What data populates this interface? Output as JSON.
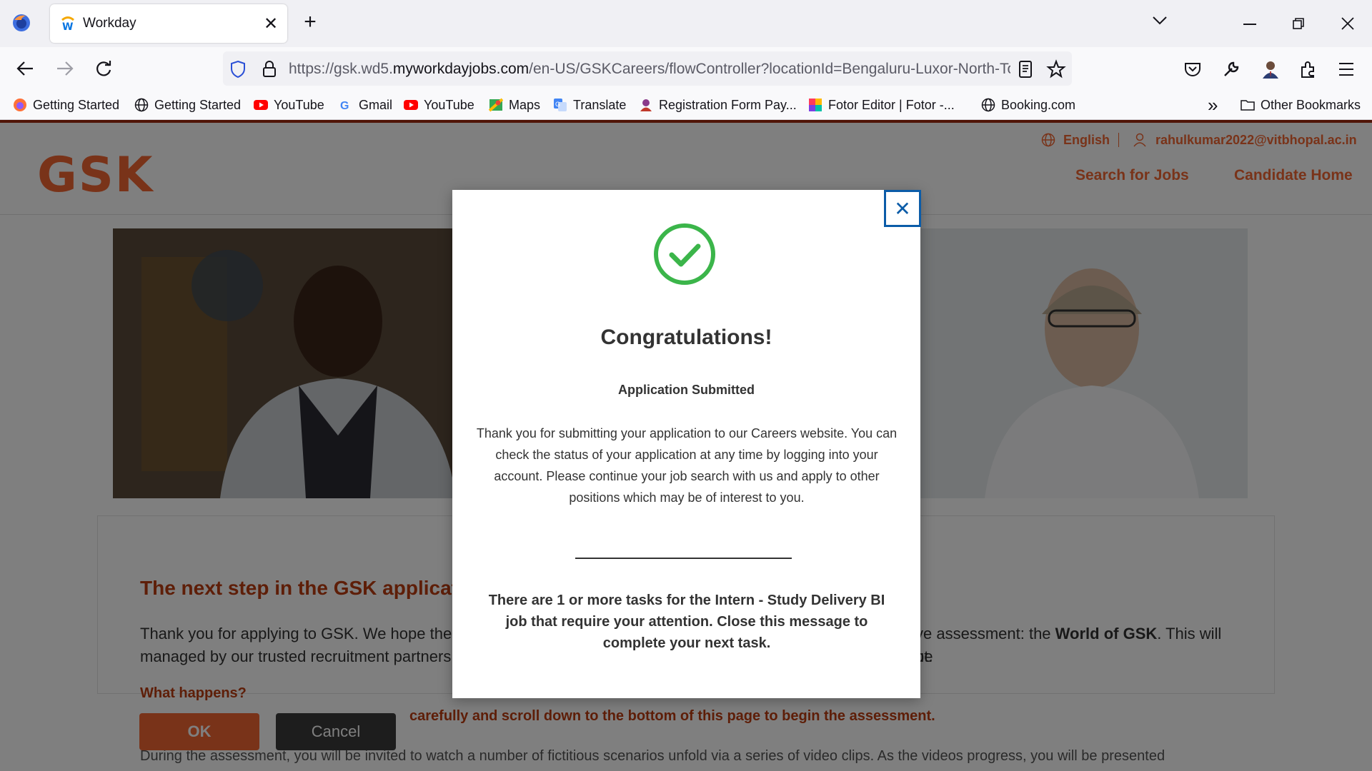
{
  "browser": {
    "tab_title": "Workday",
    "tab_close": "✕",
    "new_tab": "+",
    "url_prefix": "https://gsk.wd5.",
    "url_domain": "myworkdayjobs.com",
    "url_suffix": "/en-US/GSKCareers/flowController?locationId=Bengaluru-Luxor-North-To",
    "bookmarks": [
      {
        "label": "Getting Started",
        "icon": "firefox-icon"
      },
      {
        "label": "Getting Started",
        "icon": "globe-icon"
      },
      {
        "label": "YouTube",
        "icon": "youtube-icon"
      },
      {
        "label": "Gmail",
        "icon": "google-icon"
      },
      {
        "label": "YouTube",
        "icon": "youtube-icon"
      },
      {
        "label": "Maps",
        "icon": "maps-icon"
      },
      {
        "label": "Translate",
        "icon": "translate-icon"
      },
      {
        "label": "Registration Form Pay...",
        "icon": "user-icon"
      },
      {
        "label": "Fotor Editor  |  Fotor -...",
        "icon": "fotor-icon"
      },
      {
        "label": "Booking.com",
        "icon": "globe-icon"
      }
    ],
    "other_bookmarks": "Other Bookmarks",
    "overflow_bookmarks": "»"
  },
  "header": {
    "language": "English",
    "account": "rahulkumar2022@vitbhopal.ac.in",
    "nav": [
      "Search for Jobs",
      "Candidate Home"
    ],
    "logo_text": "GSK"
  },
  "content": {
    "heading": "The next step in the GSK application",
    "body_left": "Thank you for applying to GSK. We hope the ex",
    "body_left2": "managed by our trusted recruitment partners, C",
    "body_right": "ve assessment: the",
    "body_right_bold": "World of GSK",
    "body_right2": ". This will be",
    "body_right3": "ut.",
    "what_happens": "What happens?",
    "instructions": "carefully and scroll down to the bottom of this page to begin the assessment.",
    "during": "During the assessment, you will be invited to watch a number of fictitious scenarios unfold via a series of video clips. As the videos progress, you will be presented"
  },
  "buttons": {
    "ok": "OK",
    "cancel": "Cancel"
  },
  "modal": {
    "close": "✕",
    "title": "Congratulations!",
    "subtitle": "Application Submitted",
    "text": "Thank you for submitting your application to our Careers website.  You can check the status of your application at any time by logging into your account.  Please continue your job search with us and apply to other positions which may be of interest to you.",
    "task_text": "There are 1 or more tasks for the Intern - Study Delivery BI job that require your attention. Close this message to complete your next task."
  },
  "colors": {
    "brand_orange": "#f36633",
    "dark_orange": "#bc3c10",
    "success_green": "#3bb54a",
    "close_blue": "#0b5ca8"
  }
}
